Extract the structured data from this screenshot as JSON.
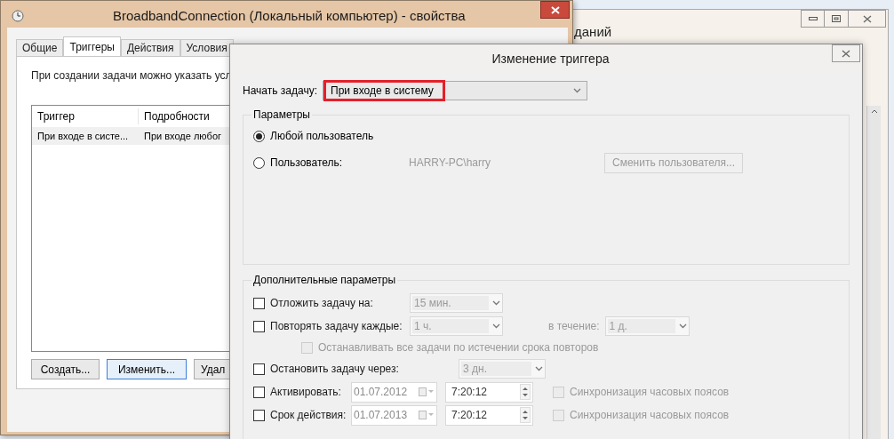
{
  "back_window": {
    "title": "даний"
  },
  "properties_window": {
    "title": "BroadbandConnection (Локальный компьютер) - свойства",
    "tabs": [
      {
        "label": "Общие",
        "selected": false
      },
      {
        "label": "Триггеры",
        "selected": true
      },
      {
        "label": "Действия",
        "selected": false
      },
      {
        "label": "Условия",
        "selected": false
      }
    ],
    "description": "При создании задачи можно указать усл",
    "table": {
      "columns": [
        "Триггер",
        "Подробности"
      ],
      "rows": [
        [
          "При входе в систе...",
          "При входе любог"
        ]
      ]
    },
    "buttons": [
      {
        "label": "Создать...",
        "focused": false
      },
      {
        "label": "Изменить...",
        "focused": true
      },
      {
        "label": "Удал",
        "focused": false
      }
    ]
  },
  "trigger_dialog": {
    "title": "Изменение триггера",
    "begin_label": "Начать задачу:",
    "begin_value": "При входе в систему",
    "highlighted": true,
    "parameters": {
      "title": "Параметры",
      "options": [
        {
          "label": "Любой пользователь",
          "selected": true
        },
        {
          "label": "Пользователь:",
          "selected": false,
          "value": "HARRY-PC\\harry"
        }
      ],
      "change_user_button": {
        "label": "Сменить пользователя...",
        "disabled": true
      }
    },
    "advanced": {
      "title": "Дополнительные параметры",
      "rows": [
        {
          "kind": "select",
          "label": "Отложить задачу на:",
          "checked": false,
          "value": "15 мин."
        },
        {
          "kind": "repeat",
          "label": "Повторять задачу каждые:",
          "checked": false,
          "value": "1 ч.",
          "duration_label": "в течение:",
          "duration_value": "1 д."
        },
        {
          "kind": "sub",
          "label": "Останавливать все задачи по истечении срока повторов",
          "checked": false,
          "disabled": true
        },
        {
          "kind": "stop",
          "label": "Остановить задачу через:",
          "checked": false,
          "value": "3 дн."
        },
        {
          "kind": "date",
          "label": "Активировать:",
          "checked": false,
          "date": "01.07.2012",
          "time": "7:20:12",
          "sync_label": "Синхронизация часовых поясов",
          "sync_checked": false
        },
        {
          "kind": "date",
          "label": "Срок действия:",
          "checked": false,
          "date": "01.07.2013",
          "time": "7:20:12",
          "sync_label": "Синхронизация часовых поясов",
          "sync_checked": false
        }
      ]
    }
  }
}
